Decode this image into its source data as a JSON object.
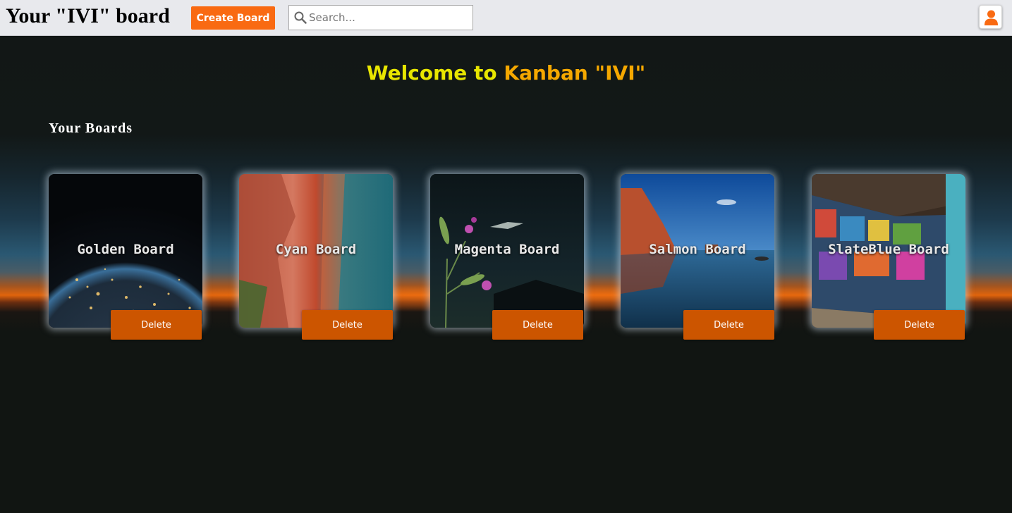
{
  "header": {
    "title": "Your \"IVI\" board",
    "create_label": "Create Board",
    "search_placeholder": "Search...",
    "search_icon": "magnifier-icon",
    "profile_icon": "user-icon",
    "accent": "#f96a12"
  },
  "main": {
    "welcome_prefix": "Welcome to ",
    "welcome_highlight": "Kanban \"IVI\"",
    "section_title": "Your Boards",
    "delete_color": "#cc5500",
    "boards": [
      {
        "name": "Golden Board",
        "delete_label": "Delete"
      },
      {
        "name": "Cyan Board",
        "delete_label": "Delete"
      },
      {
        "name": "Magenta Board",
        "delete_label": "Delete"
      },
      {
        "name": "Salmon Board",
        "delete_label": "Delete"
      },
      {
        "name": "SlateBlue Board",
        "delete_label": "Delete"
      }
    ]
  }
}
